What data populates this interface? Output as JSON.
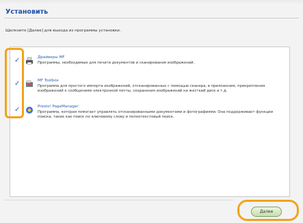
{
  "window": {
    "title": "Установить",
    "instruction": "Щелкните [Далее] для выхода из программы установки."
  },
  "items": [
    {
      "title": "Драйверы MF",
      "description": "Программы, необходимые для печати документов и сканирования изображений.",
      "checked": true,
      "check_symbol": "✓",
      "icon": "printer-icon"
    },
    {
      "title": "MF Toolbox",
      "description": "Программа для простого импорта изображений, отсканированных с помощью сканера, в приложения, прикрепления изображений к сообщениям электронной почты, сохранения изображений на жесткий диск и т.д.",
      "checked": true,
      "check_symbol": "✓",
      "icon": "toolbox-icon"
    },
    {
      "title": "Presto! PageManager",
      "description": "Программа, которая помогает управлять отсканированными документами и фотографиями. Она поддерживает функции поиска, такие как поиск по ключевому слову и полнотекстовый поиск.",
      "checked": true,
      "check_symbol": "✓",
      "icon": "pagemanager-icon"
    }
  ],
  "footer": {
    "next_label": "Далее"
  },
  "colors": {
    "title": "#1f4fa8",
    "link": "#2b5fb7",
    "highlight": "#f2a31b",
    "button": "#c4dfae"
  }
}
